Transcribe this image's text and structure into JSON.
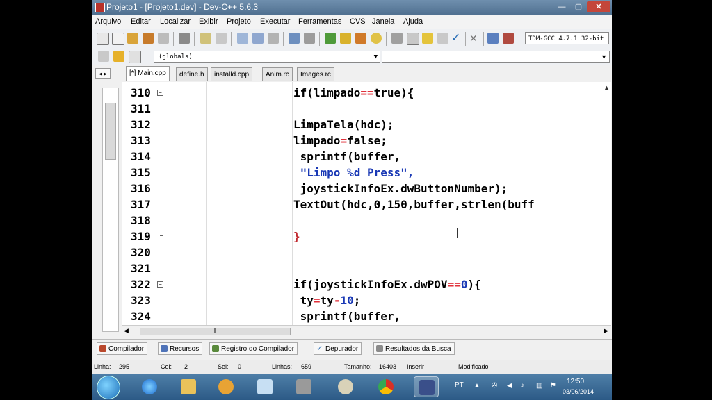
{
  "window": {
    "title": "Projeto1 - [Projeto1.dev] - Dev-C++ 5.6.3"
  },
  "menu": [
    "Arquivo",
    "Editar",
    "Localizar",
    "Exibir",
    "Projeto",
    "Executar",
    "Ferramentas",
    "CVS",
    "Janela",
    "Ajuda"
  ],
  "toolbar": {
    "compiler": "TDM-GCC 4.7.1 32-bit"
  },
  "scope": {
    "value": "(globals)"
  },
  "tabs": [
    "[*] Main.cpp",
    "define.h",
    "installd.cpp",
    "Anim.rc",
    "Images.rc"
  ],
  "editor": {
    "lines": [
      {
        "n": "310"
      },
      {
        "n": "311"
      },
      {
        "n": "312"
      },
      {
        "n": "313"
      },
      {
        "n": "314"
      },
      {
        "n": "315"
      },
      {
        "n": "316"
      },
      {
        "n": "317"
      },
      {
        "n": "318"
      },
      {
        "n": "319"
      },
      {
        "n": "320"
      },
      {
        "n": "321"
      },
      {
        "n": "322"
      },
      {
        "n": "323"
      },
      {
        "n": "324"
      }
    ],
    "code": {
      "l310a": "if(limpado",
      "l310op": "==",
      "l310b": "true){",
      "l312": "LimpaTela(hdc);",
      "l313a": "limpado",
      "l313op": "=",
      "l313b": "false;",
      "l314": " sprintf(buffer,",
      "l315": " \"Limpo %d Press\",",
      "l316": " joystickInfoEx.dwButtonNumber);",
      "l317": "TextOut(hdc,0,150,buffer,strlen(buff",
      "l319": "}",
      "l322a": "if(joystickInfoEx.dwPOV",
      "l322op": "==",
      "l322num": "0",
      "l322b": "){",
      "l323a": " ty",
      "l323op1": "=",
      "l323b": "ty",
      "l323op2": "-",
      "l323num": "10",
      "l323c": ";",
      "l324": " sprintf(buffer,"
    }
  },
  "bottom_tabs": [
    "Compilador",
    "Recursos",
    "Registro do Compilador",
    "Depurador",
    "Resultados da Busca"
  ],
  "status": {
    "linha_label": "Linha:",
    "linha": "295",
    "col_label": "Col:",
    "col": "2",
    "sel_label": "Sel:",
    "sel": "0",
    "linhas_label": "Linhas:",
    "linhas": "659",
    "tamanho_label": "Tamanho:",
    "tamanho": "16403",
    "mode": "Inserir",
    "state": "Modificado"
  },
  "taskbar": {
    "lang": "PT",
    "time": "12:50",
    "date": "03/06/2014"
  },
  "colors": {
    "operator": "#e0303a",
    "number": "#1a39b5",
    "string": "#1a39b5",
    "brace": "#c0282e"
  }
}
